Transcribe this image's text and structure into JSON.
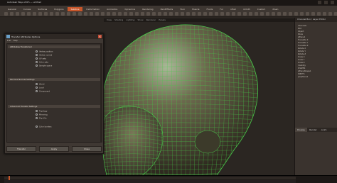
{
  "window": {
    "title": "Autodesk Maya 2015 — untitled"
  },
  "shelf": {
    "tabs": [
      "General",
      "Curves",
      "Surfaces",
      "Polygons",
      "Subdivs",
      "Deformation",
      "Animation",
      "Dynamics",
      "Rendering",
      "PaintEffects",
      "Toon",
      "Muscle",
      "Fluids",
      "Fur",
      "nHair",
      "nCloth",
      "Custom",
      "XGen"
    ],
    "active_index": 4
  },
  "viewport": {
    "menu": [
      "View",
      "Shading",
      "Lighting",
      "Show",
      "Renderer",
      "Panels"
    ],
    "mesh_color": "#49c84a",
    "skin_color": "#6f6450"
  },
  "dialog": {
    "title": "Transfer Attributes Options",
    "menu": [
      "Edit",
      "Help"
    ],
    "sections": [
      {
        "label": "Attributes Transferred"
      },
      {
        "label": "Per-face Normal Settings"
      },
      {
        "label": "Advanced Transfer Settings"
      }
    ],
    "options": [
      "Vertex position",
      "Vertex normal",
      "UV sets",
      "Color sets",
      "Sample space",
      "World",
      "Local",
      "Component",
      "Topology",
      "Mirroring",
      "Flip UVs",
      "Color borders"
    ],
    "buttons": {
      "apply_close": "Transfer",
      "apply": "Apply",
      "close": "Close"
    }
  },
  "right_panel": {
    "header": "Channel Box / Layer Editor",
    "rows": [
      "Channels",
      "Edit",
      "Object",
      "Show",
      "pPlane1",
      "Translate X",
      "Translate Y",
      "Translate Z",
      "Rotate X",
      "Rotate Y",
      "Rotate Z",
      "Scale X",
      "Scale Y",
      "Scale Z",
      "Visibility",
      "SHAPES",
      "pPlaneShape1",
      "INPUTS",
      "polyPlane1"
    ],
    "tabs": [
      "Display",
      "Render",
      "Anim"
    ]
  }
}
